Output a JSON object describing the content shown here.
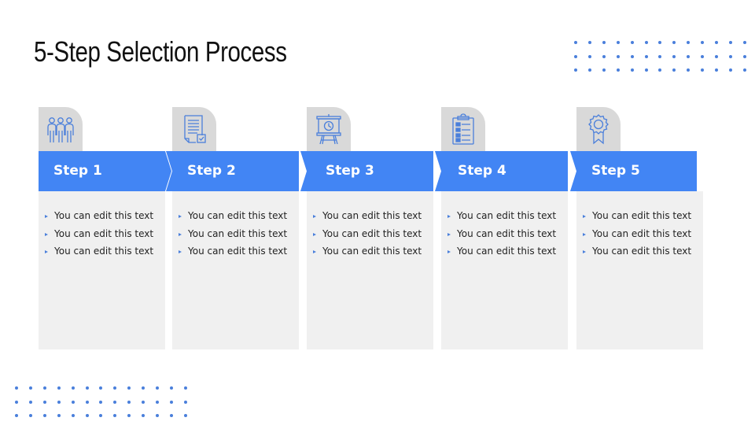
{
  "slide": {
    "title": "5-Step Selection Process",
    "accent_color": "#4285f4",
    "card_color": "#f0f0f0",
    "tab_color": "#d9d9d9",
    "steps": [
      {
        "label": "Step 1",
        "icon": "team-people-icon",
        "bullets": [
          "You can edit this text",
          "You can edit this text",
          "You can edit this text"
        ]
      },
      {
        "label": "Step 2",
        "icon": "document-check-icon",
        "bullets": [
          "You can edit this text",
          "You can edit this text",
          "You can edit this text"
        ]
      },
      {
        "label": "Step 3",
        "icon": "presentation-board-icon",
        "bullets": [
          "You can edit this text",
          "You can edit this text",
          "You can edit this text"
        ]
      },
      {
        "label": "Step 4",
        "icon": "clipboard-checklist-icon",
        "bullets": [
          "You can edit this text",
          "You can edit this text",
          "You can edit this text"
        ]
      },
      {
        "label": "Step 5",
        "icon": "award-ribbon-icon",
        "bullets": [
          "You can edit this text",
          "You can edit this text",
          "You can edit this text"
        ]
      }
    ]
  }
}
